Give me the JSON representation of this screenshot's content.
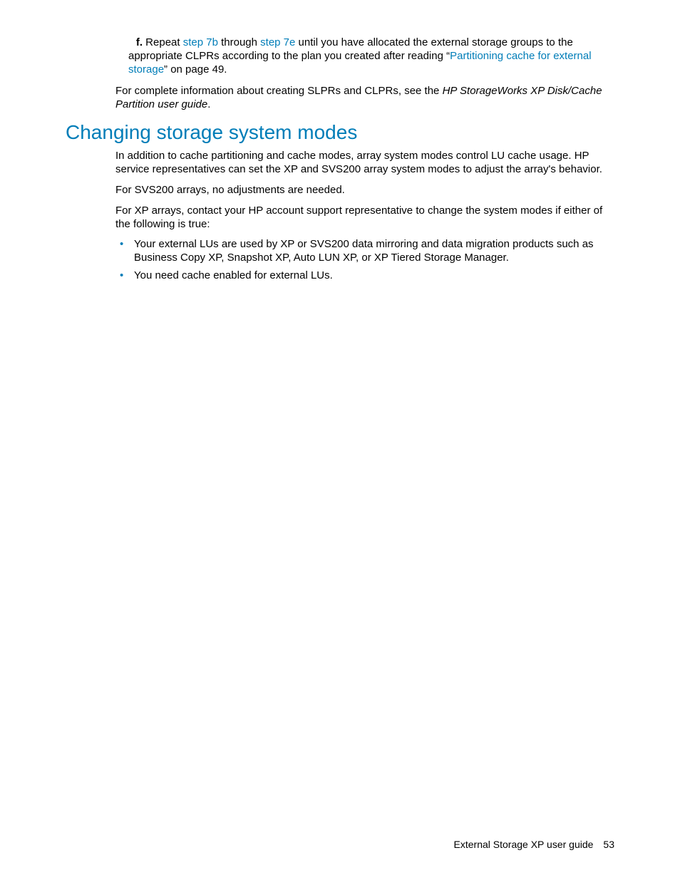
{
  "step": {
    "label": "f.",
    "pre": "Repeat ",
    "link1": "step 7b",
    "mid1": " through ",
    "link2": "step 7e",
    "mid2": " until you have allocated the external storage groups to the appropriate CLPRs according to the plan you created after reading “",
    "link3": "Partitioning cache for external storage",
    "post": "” on page 49."
  },
  "closing": {
    "pre": "For complete information about creating SLPRs and CLPRs, see the ",
    "em": "HP StorageWorks XP Disk/Cache Partition user guide",
    "post": "."
  },
  "heading": "Changing storage system modes",
  "paras": {
    "p1": "In addition to cache partitioning and cache modes, array system modes control LU cache usage. HP service representatives can set the XP and SVS200 array system modes to adjust the array's behavior.",
    "p2": "For SVS200 arrays, no adjustments are needed.",
    "p3": "For XP arrays, contact your HP account support representative to change the system modes if either of the following is true:"
  },
  "bullets": {
    "b1": "Your external LUs are used by XP or SVS200 data mirroring and data migration products such as Business Copy XP, Snapshot XP, Auto LUN XP, or XP Tiered Storage Manager.",
    "b2": "You need cache enabled for external LUs."
  },
  "footer": {
    "title": "External Storage XP user guide",
    "page": "53"
  }
}
